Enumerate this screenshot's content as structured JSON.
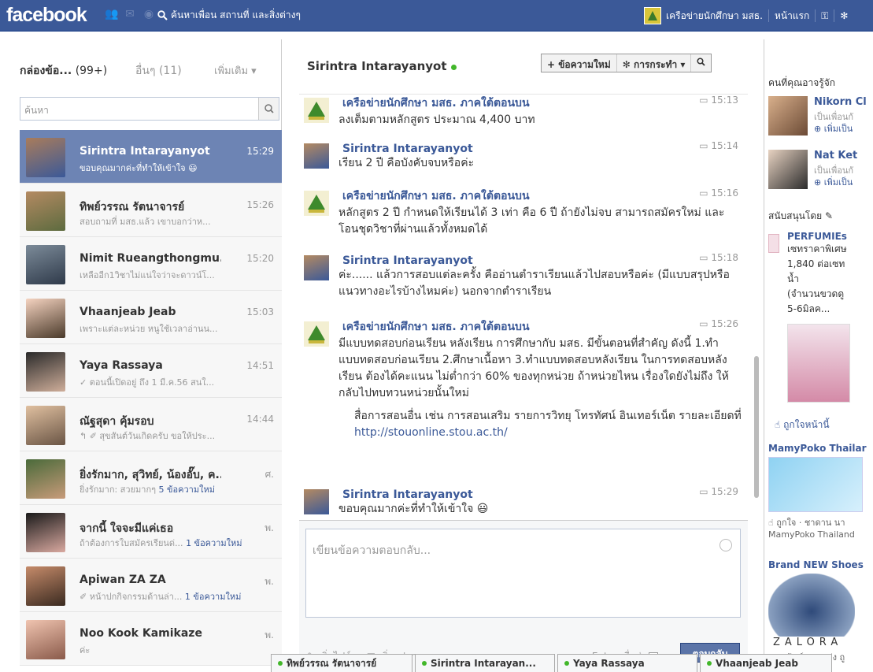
{
  "topbar": {
    "logo": "facebook",
    "search_placeholder": "ค้นหาเพื่อน สถานที่ และสิ่งต่างๆ",
    "page_name": "เครือข่ายนักศึกษา มสธ.",
    "home": "หน้าแรก",
    "color": "#3b5998"
  },
  "left": {
    "inbox_label": "กล่องข้อ...",
    "inbox_count": "(99+)",
    "other_label": "อื่นๆ (11)",
    "more_label": "เพิ่มเติม ▾",
    "search_placeholder": "ค้นหา",
    "threads": [
      {
        "name": "Sirintra Intarayanyot",
        "time": "15:29",
        "snippet": "ขอบคุณมากค่ะที่ทำให้เข้าใจ 😃",
        "active": true
      },
      {
        "name": "ทิพย์วรรณ รัตนาจารย์",
        "time": "15:26",
        "snippet": "สอบถามที่ มสธ.แล้ว เขาบอกว่าห..."
      },
      {
        "name": "Nimit Rueangthongmu...",
        "time": "15:20",
        "snippet": "เหลืออีก1วิชาไม่แน่ใจว่าจะดาวน์โ..."
      },
      {
        "name": "Vhaanjeab Jeab",
        "time": "15:03",
        "snippet": "เพราะแต่ละหน่วย หนูใช้เวลาอ่านน..."
      },
      {
        "name": "Yaya Rassaya",
        "time": "14:51",
        "snippet": "✓ ตอนนี้เปิดอยู่ ถึง 1 มี.ค.56 สนใ..."
      },
      {
        "name": "ณัฐสุดา คุ้มรอบ",
        "time": "14:44",
        "snippet": "↰ ✐ สุขสันต์วันเกิดครับ ขอให้ประ..."
      },
      {
        "name": "ยิ่งรักมาก, สุวิทย์, น้องอั๊บ, ค...",
        "time": "ศ.",
        "snippet": "ยิ่งรักมาก: สวยมากๆ",
        "new": "5 ข้อความใหม่"
      },
      {
        "name": "จากนี้ ใจจะมีแค่เธอ",
        "time": "พ.",
        "snippet": "ถ้าต้องการใบสมัครเรียนด่...",
        "new": "1 ข้อความใหม่"
      },
      {
        "name": "Apiwan ZA ZA",
        "time": "พ.",
        "snippet": "✐ หน้าปกกิจกรรมด้านล่า...",
        "new": "1 ข้อความใหม่"
      },
      {
        "name": "Noo Kook Kamikaze",
        "time": "พ.",
        "snippet": "ค่ะ"
      }
    ]
  },
  "conversation": {
    "name": "Sirintra Intarayanyot",
    "new_message": "+ ข้อความใหม่",
    "actions": "✻ การกระทำ ▾",
    "messages": [
      {
        "sender": "เครือข่ายนักศึกษา มสธ. ภาคใต้ตอนบน",
        "time": "15:13",
        "text": "ลงเต็มตามหลักสูตร ประมาณ 4,400 บาท",
        "page": true
      },
      {
        "sender": "Sirintra Intarayanyot",
        "time": "15:14",
        "text": "เรียน 2 ปี คือบังคับจบหรือค่ะ"
      },
      {
        "sender": "เครือข่ายนักศึกษา มสธ. ภาคใต้ตอนบน",
        "time": "15:16",
        "text": "หลักสูตร 2 ปี กำหนดให้เรียนได้ 3 เท่า คือ 6 ปี ถ้ายังไม่จบ สามารถสมัครใหม่ และโอนชุดวิชาที่ผ่านแล้วทั้งหมดได้",
        "page": true
      },
      {
        "sender": "Sirintra Intarayanyot",
        "time": "15:18",
        "text": "ค่ะ...... แล้วการสอบแต่ละครั้ง คืออ่านตำราเรียนแล้วไปสอบหรือค่ะ (มีแบบสรุปหรือแนวทางอะไรบ้างไหมค่ะ) นอกจากตำราเรียน"
      },
      {
        "sender": "เครือข่ายนักศึกษา มสธ. ภาคใต้ตอนบน",
        "time": "15:26",
        "text": "มีแบบทดสอบก่อนเรียน หลังเรียน การศึกษากับ มสธ. มีขั้นตอนที่สำคัญ ดังนี้ 1.ทำแบบทดสอบก่อนเรียน 2.ศึกษาเนื้อหา 3.ทำแบบทดสอบหลังเรียน ในการทดสอบหลังเรียน ต้องได้คะแนน ไม่ต่ำกว่า 60% ของทุกหน่วย ถ้าหน่วยไหน เรื่องใดยังไม่ถึง ให้กลับไปทบทวนหน่วยนั้นใหม่",
        "text2": "สื่อการสอนอื่น เช่น การสอนเสริม รายการวิทยุ โทรทัศน์ อินเทอร์เน็ต รายละเอียดที่",
        "link": "http://stouonline.stou.ac.th/",
        "page": true
      },
      {
        "sender": "Sirintra Intarayanyot",
        "time": "15:29",
        "text": "ขอบคุณมากค่ะที่ทำให้เข้าใจ 😃"
      }
    ]
  },
  "reply": {
    "placeholder": "เขียนข้อความตอบกลับ...",
    "add_file": "เพิ่มไฟล์",
    "add_photo": "เพิ่มรูปภาพ",
    "enter_send": "กด Enter เพื่อส่ง",
    "send": "ตอบกลับ"
  },
  "right": {
    "pymk_title": "คนที่คุณอาจรู้จัก",
    "people": [
      {
        "name": "Nikorn Cl",
        "sub": "เป็นเพื่อนกั",
        "add": "⊕ เพิ่มเป็น"
      },
      {
        "name": "Nat Ket",
        "sub": "เป็นเพื่อนกั",
        "add": "⊕ เพิ่มเป็น"
      }
    ],
    "sponsored": "สนับสนุนโดย",
    "ad1_title": "PERFUMIEs",
    "ad1_text": [
      "เซทราคาพิเศษ",
      "1,840 ต่อเซท",
      "น้ำ",
      "(จำนวนขวดดู",
      "5-6มิลค..."
    ],
    "ad1_like": "ถูกใจหน้านี้",
    "ad2_title": "MamyPoko Thailar",
    "ad2_like": "ถูกใจ · ชาดาน นา",
    "ad2_name": "MamyPoko Thailand",
    "ad3_title": "Brand NEW Shoes",
    "ad3_brand": "ZALORA",
    "ad3_foot": "นนทนันท์ ทองแท่ง ถู"
  },
  "chat_tabs": [
    "ทิพย์วรรณ รัตนาจารย์",
    "Sirintra Intarayan...",
    "Yaya Rassaya",
    "Vhaanjeab Jeab"
  ]
}
